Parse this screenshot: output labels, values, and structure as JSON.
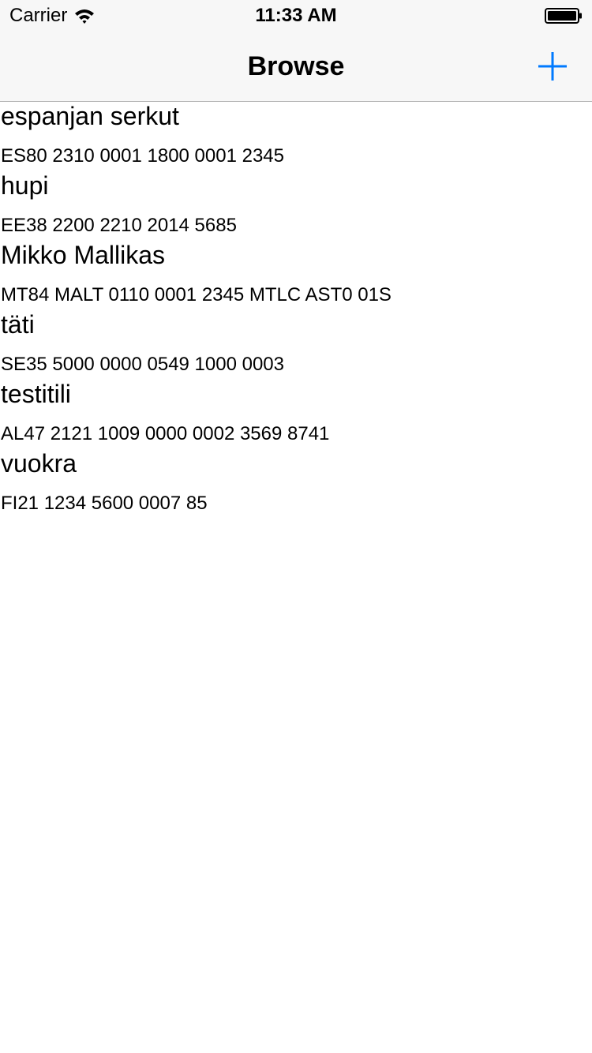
{
  "status_bar": {
    "carrier": "Carrier",
    "time": "11:33 AM",
    "icons": [
      "wifi-icon",
      "battery-icon"
    ]
  },
  "nav": {
    "title": "Browse",
    "add_icon": "plus-icon",
    "accent_color": "#007aff"
  },
  "accounts": [
    {
      "name": "espanjan serkut",
      "iban": "ES80 2310 0001 1800 0001 2345"
    },
    {
      "name": "hupi",
      "iban": "EE38 2200 2210 2014 5685"
    },
    {
      "name": "Mikko Mallikas",
      "iban": "MT84 MALT 0110 0001 2345 MTLC AST0 01S"
    },
    {
      "name": "täti",
      "iban": "SE35 5000 0000 0549 1000 0003"
    },
    {
      "name": "testitili",
      "iban": "AL47 2121 1009 0000 0002 3569 8741"
    },
    {
      "name": "vuokra",
      "iban": "FI21 1234 5600 0007 85"
    }
  ]
}
